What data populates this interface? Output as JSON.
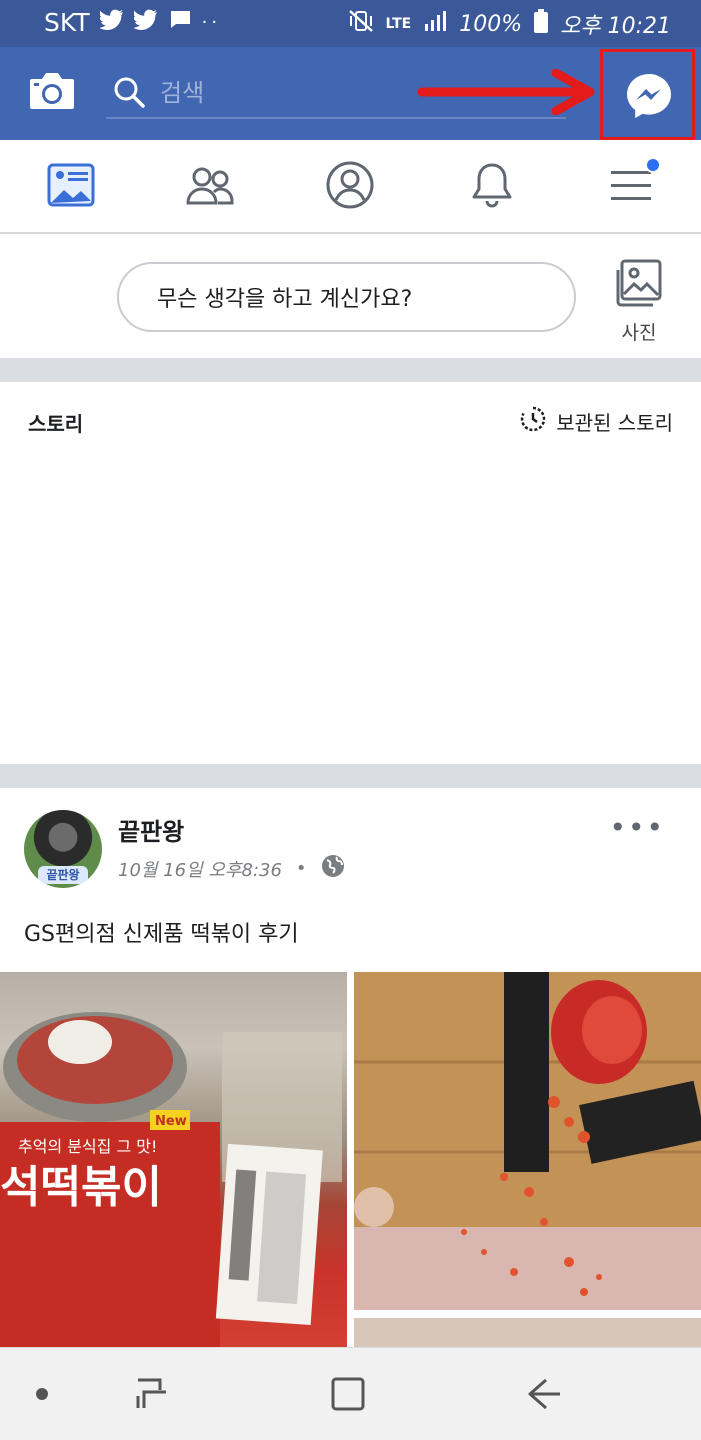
{
  "status_bar": {
    "carrier": "SKT",
    "network": "LTE",
    "battery": "100%",
    "time": "오후 10:21"
  },
  "header": {
    "search_placeholder": "검색",
    "icons": [
      "camera-icon",
      "search-icon",
      "messenger-icon"
    ],
    "highlight_color": "#e41b1b",
    "brand_color": "#4267b2"
  },
  "nav_tabs": [
    "news-feed-icon",
    "friends-icon",
    "profile-icon",
    "notifications-icon",
    "menu-icon"
  ],
  "composer": {
    "prompt": "무슨 생각을 하고 계신가요?",
    "photo_label": "사진"
  },
  "stories": {
    "title": "스토리",
    "archive_label": "보관된 스토리"
  },
  "post": {
    "author": "끝판왕",
    "avatar_tag": "끝판왕",
    "timestamp": "10월 16일 오후8:36",
    "separator": "•",
    "privacy": "globe-icon",
    "text": "GS편의점 신제품 떡볶이 후기",
    "more": "•••",
    "photo_text": {
      "new_badge": "New",
      "product_tagline": "추억의 분식집 그 맛!",
      "product_name": "석떡볶이"
    }
  },
  "bottom_nav": [
    "dot-icon",
    "recent-apps-icon",
    "home-icon",
    "back-icon"
  ]
}
